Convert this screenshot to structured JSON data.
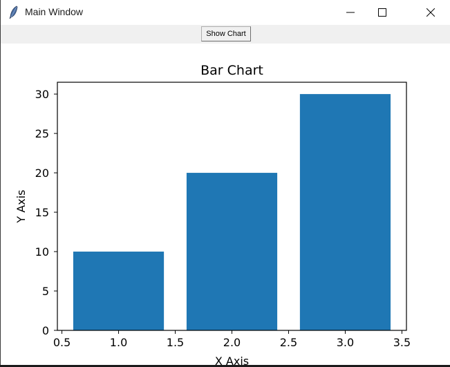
{
  "window": {
    "title": "Main Window",
    "icon": "feather-icon",
    "controls": [
      "minimize-icon",
      "maximize-icon",
      "close-icon"
    ]
  },
  "toolbar": {
    "show_chart_label": "Show Chart"
  },
  "chart_data": {
    "type": "bar",
    "title": "Bar Chart",
    "xlabel": "X Axis",
    "ylabel": "Y Axis",
    "x": [
      1.0,
      2.0,
      3.0
    ],
    "values": [
      10,
      20,
      30
    ],
    "bar_width": 0.8,
    "color": "#1f77b4",
    "xlim": [
      0.46,
      3.54
    ],
    "ylim": [
      0,
      31.5
    ],
    "xticks": [
      0.5,
      1.0,
      1.5,
      2.0,
      2.5,
      3.0,
      3.5
    ],
    "xtick_labels": [
      "0.5",
      "1.0",
      "1.5",
      "2.0",
      "2.5",
      "3.0",
      "3.5"
    ],
    "yticks": [
      0,
      5,
      10,
      15,
      20,
      25,
      30
    ],
    "ytick_labels": [
      "0",
      "5",
      "10",
      "15",
      "20",
      "25",
      "30"
    ],
    "grid": false,
    "legend": null
  }
}
